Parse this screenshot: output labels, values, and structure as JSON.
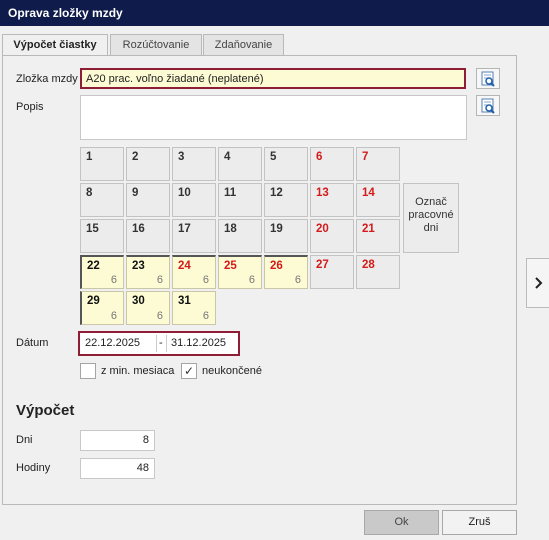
{
  "window": {
    "title": "Oprava zložky mzdy"
  },
  "tabs": [
    {
      "label": "Výpočet čiastky"
    },
    {
      "label": "Rozúčtovanie"
    },
    {
      "label": "Zdaňovanie"
    }
  ],
  "form": {
    "zlozka_label": "Zložka mzdy",
    "zlozka_value": "A20  prac. voľno žiadané (neplatené)",
    "popis_label": "Popis",
    "popis_value": "",
    "datum_label": "Dátum",
    "date_from": "22.12.2025",
    "date_sep": "-",
    "date_to": "31.12.2025",
    "checkbox_min_mesiaca": {
      "label": "z min. mesiaca",
      "checked": false
    },
    "checkbox_neukoncene": {
      "label": "neukončené",
      "checked": true,
      "mark": "✓"
    }
  },
  "calendar": {
    "days": [
      {
        "d": "1"
      },
      {
        "d": "2"
      },
      {
        "d": "3"
      },
      {
        "d": "4"
      },
      {
        "d": "5"
      },
      {
        "d": "6",
        "weekend": true
      },
      {
        "d": "7",
        "weekend": true
      },
      {
        "d": "8"
      },
      {
        "d": "9"
      },
      {
        "d": "10"
      },
      {
        "d": "11"
      },
      {
        "d": "12"
      },
      {
        "d": "13",
        "weekend": true
      },
      {
        "d": "14",
        "weekend": true
      },
      {
        "d": "15"
      },
      {
        "d": "16"
      },
      {
        "d": "17"
      },
      {
        "d": "18"
      },
      {
        "d": "19"
      },
      {
        "d": "20",
        "weekend": true
      },
      {
        "d": "21",
        "weekend": true
      },
      {
        "d": "22",
        "selected": true,
        "hours": "6"
      },
      {
        "d": "23",
        "selected": true,
        "hours": "6"
      },
      {
        "d": "24",
        "selected": true,
        "weekend": true,
        "hours": "6"
      },
      {
        "d": "25",
        "selected": true,
        "weekend": true,
        "hours": "6"
      },
      {
        "d": "26",
        "selected": true,
        "weekend": true,
        "hours": "6"
      },
      {
        "d": "27",
        "weekend": true
      },
      {
        "d": "28",
        "weekend": true
      },
      {
        "d": "29",
        "selected": true,
        "hours": "6"
      },
      {
        "d": "30",
        "selected": true,
        "hours": "6"
      },
      {
        "d": "31",
        "selected": true,
        "hours": "6"
      }
    ],
    "mark_button_label": "Označ pracovné dni"
  },
  "vypocet": {
    "heading": "Výpočet",
    "dni_label": "Dni",
    "dni_value": "8",
    "hodiny_label": "Hodiny",
    "hodiny_value": "48"
  },
  "buttons": {
    "ok": "Ok",
    "cancel": "Zruš"
  },
  "colors": {
    "titlebar": "#0e1b4b",
    "highlight_border": "#8e1d36",
    "selected_fill": "#fdfbd4",
    "weekend_text": "#d41a1a"
  }
}
